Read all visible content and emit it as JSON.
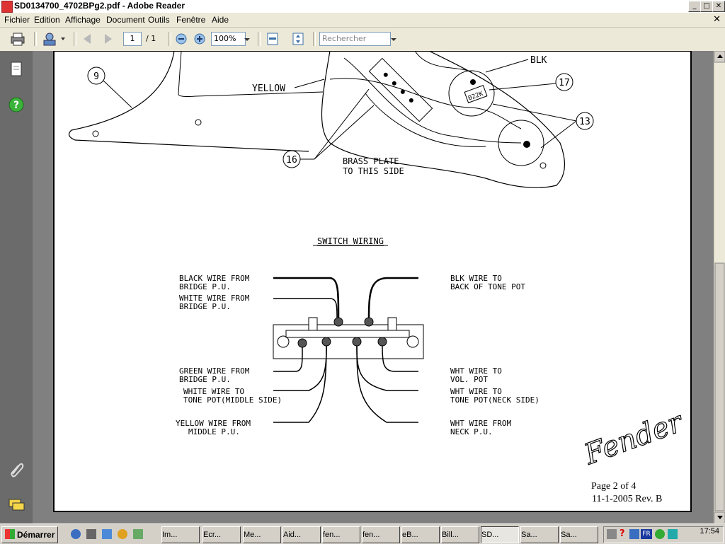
{
  "window": {
    "title": "SD0134700_4702BPg2.pdf - Adobe Reader",
    "min": "_",
    "max": "□",
    "close": "✕"
  },
  "menu": [
    "Fichier",
    "Edition",
    "Affichage",
    "Document",
    "Outils",
    "Fenêtre",
    "Aide"
  ],
  "toolbar": {
    "page_current": "1",
    "page_total": "/ 1",
    "zoom": "100%",
    "search_placeholder": "Rechercher"
  },
  "document": {
    "callouts": [
      "9",
      "16",
      "17",
      "13"
    ],
    "labels_top": {
      "yellow": "YELLOW",
      "blk": "BLK",
      "brass1": "BRASS PLATE",
      "brass2": "TO THIS SIDE",
      "cap": "022K"
    },
    "switch_title": "SWITCH WIRING",
    "left_labels": [
      [
        "BLACK WIRE FROM",
        "BRIDGE P.U."
      ],
      [
        "WHITE WIRE FROM",
        "BRIDGE P.U."
      ],
      [
        "GREEN WIRE FROM",
        "BRIDGE P.U."
      ],
      [
        "WHITE WIRE TO",
        "TONE POT(MIDDLE SIDE)"
      ],
      [
        "YELLOW WIRE FROM",
        "MIDDLE P.U."
      ]
    ],
    "right_labels": [
      [
        "BLK WIRE TO",
        "BACK OF TONE POT"
      ],
      [
        "WHT WIRE TO",
        "VOL. POT"
      ],
      [
        "WHT WIRE TO",
        "TONE POT(NECK SIDE)"
      ],
      [
        "WHT WIRE FROM",
        "NECK P.U."
      ]
    ],
    "brand": "Fender",
    "page_label": "Page 2 of 4",
    "rev_label": "11-1-2005  Rev. B"
  },
  "taskbar": {
    "start": "Démarrer",
    "tasks": [
      "Im...",
      "Ecr...",
      "Me...",
      "Aid...",
      "fen...",
      "fen...",
      "eB...",
      "Bill...",
      "SD...",
      "Sa...",
      "Sa..."
    ],
    "active_index": 8,
    "tray_lang": "FR",
    "clock": "17:54"
  }
}
